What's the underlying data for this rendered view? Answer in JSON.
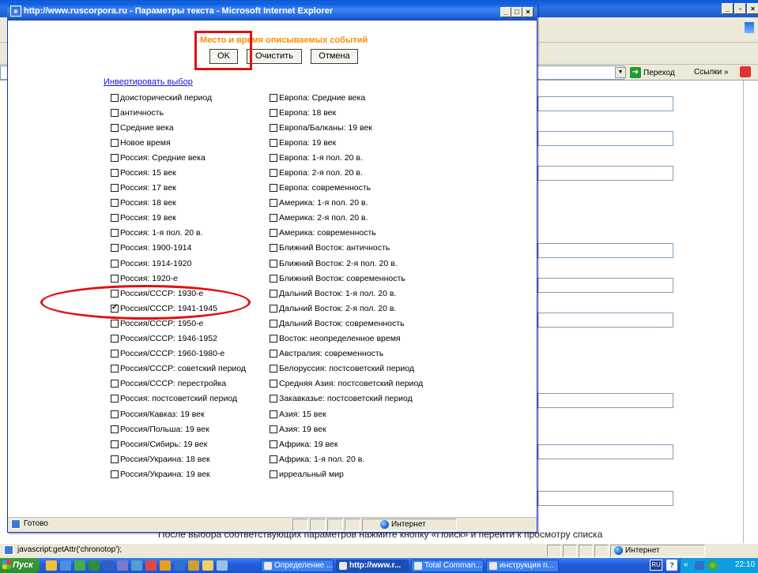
{
  "popup": {
    "title": "http://www.ruscorpora.ru - Параметры текста - Microsoft Internet Explorer",
    "section_title": "Место и время описываемых событий",
    "buttons": {
      "ok": "OK",
      "clear": "Очистить",
      "cancel": "Отмена"
    },
    "invert_link": "Инвертировать выбор",
    "status_text": "Готово",
    "status_zone": "Интернет"
  },
  "options_left": [
    {
      "label": "доисторический период",
      "checked": false
    },
    {
      "label": "античность",
      "checked": false
    },
    {
      "label": "Средние века",
      "checked": false
    },
    {
      "label": "Новое время",
      "checked": false
    },
    {
      "label": "Россия: Средние века",
      "checked": false
    },
    {
      "label": "Россия: 15 век",
      "checked": false
    },
    {
      "label": "Россия: 17 век",
      "checked": false
    },
    {
      "label": "Россия: 18 век",
      "checked": false
    },
    {
      "label": "Россия: 19 век",
      "checked": false
    },
    {
      "label": "Россия: 1-я пол. 20 в.",
      "checked": false
    },
    {
      "label": "Россия: 1900-1914",
      "checked": false
    },
    {
      "label": "Россия: 1914-1920",
      "checked": false
    },
    {
      "label": "Россия: 1920-е",
      "checked": false
    },
    {
      "label": "Россия/СССР: 1930-е",
      "checked": false
    },
    {
      "label": "Россия/СССР: 1941-1945",
      "checked": true
    },
    {
      "label": "Россия/СССР: 1950-е",
      "checked": false
    },
    {
      "label": "Россия/СССР: 1946-1952",
      "checked": false
    },
    {
      "label": "Россия/СССР: 1960-1980-е",
      "checked": false
    },
    {
      "label": "Россия/СССР: советский период",
      "checked": false
    },
    {
      "label": "Россия/СССР: перестройка",
      "checked": false
    },
    {
      "label": "Россия: постсоветский период",
      "checked": false
    },
    {
      "label": "Россия/Кавказ: 19 век",
      "checked": false
    },
    {
      "label": "Россия/Польша: 19 век",
      "checked": false
    },
    {
      "label": "Россия/Сибирь: 19 век",
      "checked": false
    },
    {
      "label": "Россия/Украина: 18 век",
      "checked": false
    },
    {
      "label": "Россия/Украина: 19 век",
      "checked": false
    }
  ],
  "options_right": [
    {
      "label": "Европа: Средние века",
      "checked": false
    },
    {
      "label": "Европа: 18 век",
      "checked": false
    },
    {
      "label": "Европа/Балканы: 19 век",
      "checked": false
    },
    {
      "label": "Европа: 19 век",
      "checked": false
    },
    {
      "label": "Европа: 1-я пол. 20 в.",
      "checked": false
    },
    {
      "label": "Европа: 2-я пол. 20 в.",
      "checked": false
    },
    {
      "label": "Европа: современность",
      "checked": false
    },
    {
      "label": "Америка: 1-я пол. 20 в.",
      "checked": false
    },
    {
      "label": "Америка: 2-я пол. 20 в.",
      "checked": false
    },
    {
      "label": "Америка: современность",
      "checked": false
    },
    {
      "label": "Ближний Восток: античность",
      "checked": false
    },
    {
      "label": "Ближний Восток: 2-я пол. 20 в.",
      "checked": false
    },
    {
      "label": "Ближний Восток: современность",
      "checked": false
    },
    {
      "label": "Дальний Восток: 1-я пол. 20 в.",
      "checked": false
    },
    {
      "label": "Дальний Восток: 2-я пол. 20 в.",
      "checked": false
    },
    {
      "label": "Дальний Восток: современность",
      "checked": false
    },
    {
      "label": "Восток: неопределенное время",
      "checked": false
    },
    {
      "label": "Австралия: современность",
      "checked": false
    },
    {
      "label": "Белоруссия: постсоветский период",
      "checked": false
    },
    {
      "label": "Средняя Азия: постсоветский период",
      "checked": false
    },
    {
      "label": "Закавказье: постсоветский период",
      "checked": false
    },
    {
      "label": "Азия: 15 век",
      "checked": false
    },
    {
      "label": "Азия: 19 век",
      "checked": false
    },
    {
      "label": "Африка: 19 век",
      "checked": false
    },
    {
      "label": "Африка: 1-я пол. 20 в.",
      "checked": false
    },
    {
      "label": "ирреальный мир",
      "checked": false
    }
  ],
  "background_window": {
    "go_label": "Переход",
    "links_label": "Ссылки",
    "bottom_text": "После выбора соответствующих параметров нажмите кнопку «Поиск» и перейти к просмотру списка",
    "status_text": "javascript:getAttr('chronotop');",
    "status_zone": "Интернет"
  },
  "taskbar": {
    "start_label": "Пуск",
    "items": [
      {
        "label": "Определение ...",
        "active": false
      },
      {
        "label": "http://www.r...",
        "active": true
      },
      {
        "label": "Total Comman...",
        "active": false
      },
      {
        "label": "инструкция п...",
        "active": false
      }
    ],
    "language": "RU",
    "clock": "22:10"
  },
  "colors": {
    "section_title": "#ff8c00",
    "link": "#1515d6",
    "highlight": "#e01010"
  }
}
